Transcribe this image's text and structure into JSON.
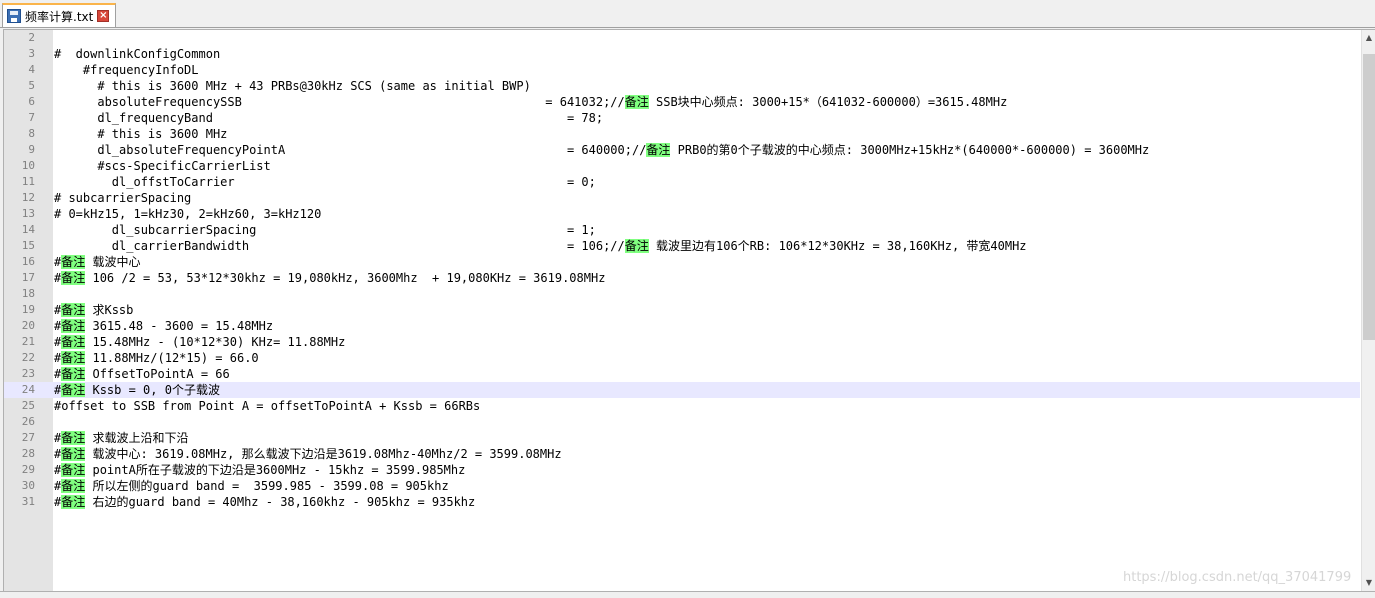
{
  "tab": {
    "label": "频率计算.txt"
  },
  "watermark": "https://blog.csdn.net/qq_37041799",
  "colors": {
    "highlight": "#80ff80",
    "current_line": "#e8e8ff",
    "gutter": "#e4e4e4",
    "tab_accent": "#fab44b"
  },
  "icons": {
    "save": "save-icon",
    "close": "close-icon"
  },
  "current_line": 24,
  "lines": [
    {
      "n": "2",
      "parts": []
    },
    {
      "n": "3",
      "parts": [
        {
          "t": "#  downlinkConfigCommon"
        }
      ]
    },
    {
      "n": "4",
      "parts": [
        {
          "t": "    #frequencyInfoDL"
        }
      ]
    },
    {
      "n": "5",
      "parts": [
        {
          "t": "      # this is 3600 MHz + 43 PRBs@30kHz SCS (same as initial BWP)"
        }
      ]
    },
    {
      "n": "6",
      "parts": [
        {
          "t": "      absoluteFrequencySSB                                          = 641032;//"
        },
        {
          "t": "备注",
          "h": true
        },
        {
          "t": " SSB块中心频点: 3000+15*（641032-600000）=3615.48MHz"
        }
      ]
    },
    {
      "n": "7",
      "parts": [
        {
          "t": "      dl_frequencyBand                                                 = 78;"
        }
      ]
    },
    {
      "n": "8",
      "parts": [
        {
          "t": "      # this is 3600 MHz"
        }
      ]
    },
    {
      "n": "9",
      "parts": [
        {
          "t": "      dl_absoluteFrequencyPointA                                       = 640000;//"
        },
        {
          "t": "备注",
          "h": true
        },
        {
          "t": " PRB0的第0个子载波的中心频点: 3000MHz+15kHz*(640000*-600000) = 3600MHz"
        }
      ]
    },
    {
      "n": "10",
      "parts": [
        {
          "t": "      #scs-SpecificCarrierList"
        }
      ]
    },
    {
      "n": "11",
      "parts": [
        {
          "t": "        dl_offstToCarrier                                              = 0;"
        }
      ]
    },
    {
      "n": "12",
      "parts": [
        {
          "t": "# subcarrierSpacing"
        }
      ]
    },
    {
      "n": "13",
      "parts": [
        {
          "t": "# 0=kHz15, 1=kHz30, 2=kHz60, 3=kHz120"
        }
      ]
    },
    {
      "n": "14",
      "parts": [
        {
          "t": "        dl_subcarrierSpacing                                           = 1;"
        }
      ]
    },
    {
      "n": "15",
      "parts": [
        {
          "t": "        dl_carrierBandwidth                                            = 106;//"
        },
        {
          "t": "备注",
          "h": true
        },
        {
          "t": " 载波里边有106个RB: 106*12*30KHz = 38,160KHz, 带宽40MHz"
        }
      ]
    },
    {
      "n": "16",
      "parts": [
        {
          "t": "#"
        },
        {
          "t": "备注",
          "h": true
        },
        {
          "t": " 载波中心"
        }
      ]
    },
    {
      "n": "17",
      "parts": [
        {
          "t": "#"
        },
        {
          "t": "备注",
          "h": true
        },
        {
          "t": " 106 /2 = 53, 53*12*30khz = 19,080kHz, 3600Mhz  + 19,080KHz = 3619.08MHz"
        }
      ]
    },
    {
      "n": "18",
      "parts": []
    },
    {
      "n": "19",
      "parts": [
        {
          "t": "#"
        },
        {
          "t": "备注",
          "h": true
        },
        {
          "t": " 求Kssb"
        }
      ]
    },
    {
      "n": "20",
      "parts": [
        {
          "t": "#"
        },
        {
          "t": "备注",
          "h": true
        },
        {
          "t": " 3615.48 - 3600 = 15.48MHz"
        }
      ]
    },
    {
      "n": "21",
      "parts": [
        {
          "t": "#"
        },
        {
          "t": "备注",
          "h": true
        },
        {
          "t": " 15.48MHz - (10*12*30) KHz= 11.88MHz"
        }
      ]
    },
    {
      "n": "22",
      "parts": [
        {
          "t": "#"
        },
        {
          "t": "备注",
          "h": true
        },
        {
          "t": " 11.88MHz/(12*15) = 66.0"
        }
      ]
    },
    {
      "n": "23",
      "parts": [
        {
          "t": "#"
        },
        {
          "t": "备注",
          "h": true
        },
        {
          "t": " OffsetToPointA = 66"
        }
      ]
    },
    {
      "n": "24",
      "parts": [
        {
          "t": "#"
        },
        {
          "t": "备注",
          "h": true
        },
        {
          "t": " Kssb = 0, 0个子载波"
        }
      ]
    },
    {
      "n": "25",
      "parts": [
        {
          "t": "#offset to SSB from Point A = offsetToPointA + Kssb = 66RBs"
        }
      ]
    },
    {
      "n": "26",
      "parts": []
    },
    {
      "n": "27",
      "parts": [
        {
          "t": "#"
        },
        {
          "t": "备注",
          "h": true
        },
        {
          "t": " 求载波上沿和下沿"
        }
      ]
    },
    {
      "n": "28",
      "parts": [
        {
          "t": "#"
        },
        {
          "t": "备注",
          "h": true
        },
        {
          "t": " 载波中心: 3619.08MHz, 那么载波下边沿是3619.08Mhz-40Mhz/2 = 3599.08MHz"
        }
      ]
    },
    {
      "n": "29",
      "parts": [
        {
          "t": "#"
        },
        {
          "t": "备注",
          "h": true
        },
        {
          "t": " pointA所在子载波的下边沿是3600MHz - 15khz = 3599.985Mhz"
        }
      ]
    },
    {
      "n": "30",
      "parts": [
        {
          "t": "#"
        },
        {
          "t": "备注",
          "h": true
        },
        {
          "t": " 所以左侧的guard band =  3599.985 - 3599.08 = 905khz"
        }
      ]
    },
    {
      "n": "31",
      "parts": [
        {
          "t": "#"
        },
        {
          "t": "备注",
          "h": true
        },
        {
          "t": " 右边的guard band = 40Mhz - 38,160khz - 905khz = 935khz"
        }
      ]
    }
  ]
}
